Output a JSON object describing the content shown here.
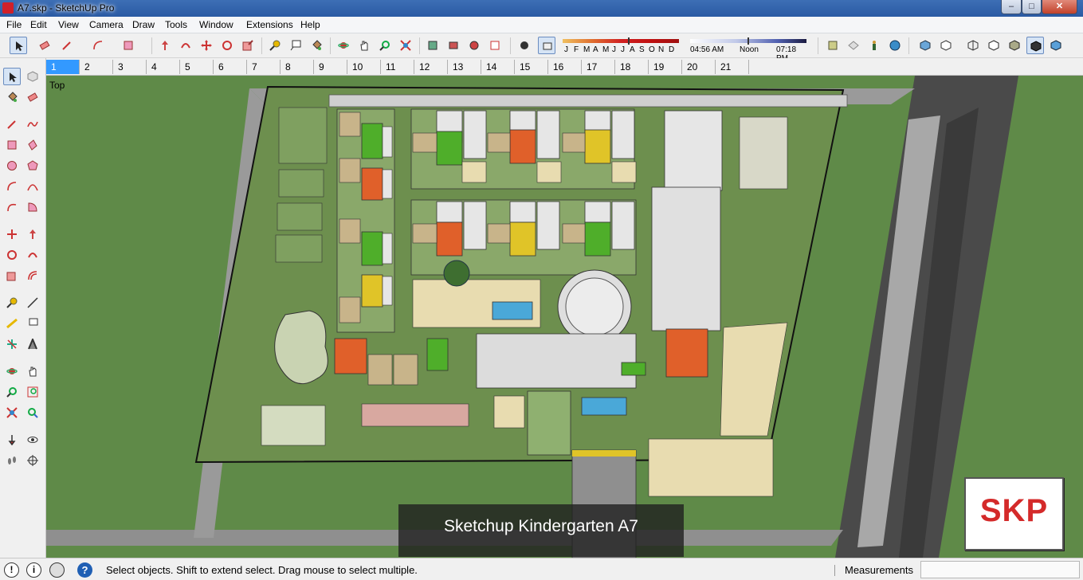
{
  "window": {
    "title": "A7.skp - SketchUp Pro",
    "controls": {
      "minimize": "–",
      "maximize": "□",
      "close": "✕"
    }
  },
  "menu": [
    "File",
    "Edit",
    "View",
    "Camera",
    "Draw",
    "Tools",
    "Window",
    "Extensions",
    "Help"
  ],
  "shadow_settings": {
    "months": [
      "J",
      "F",
      "M",
      "A",
      "M",
      "J",
      "J",
      "A",
      "S",
      "O",
      "N",
      "D"
    ],
    "sunrise": "04:56 AM",
    "noon": "Noon",
    "sunset": "07:18 PM"
  },
  "scene_tabs": [
    "1",
    "2",
    "3",
    "4",
    "5",
    "6",
    "7",
    "8",
    "9",
    "10",
    "11",
    "12",
    "13",
    "14",
    "15",
    "16",
    "17",
    "18",
    "19",
    "20",
    "21"
  ],
  "active_scene": "1",
  "viewport": {
    "view_label": "Top",
    "caption": "Sketchup Kindergarten A7",
    "logo_text": "SKP"
  },
  "status": {
    "message": "Select objects. Shift to extend select. Drag mouse to select multiple.",
    "measurements_label": "Measurements",
    "measurements_value": "",
    "info_glyph": "i",
    "geo_glyph": "!",
    "help_glyph": "?"
  },
  "colors": {
    "grass": "#5f8a48",
    "road": "#4a4a4a",
    "accent_orange": "#e0602a",
    "accent_green": "#4fae2a",
    "accent_yellow": "#e0c428"
  }
}
